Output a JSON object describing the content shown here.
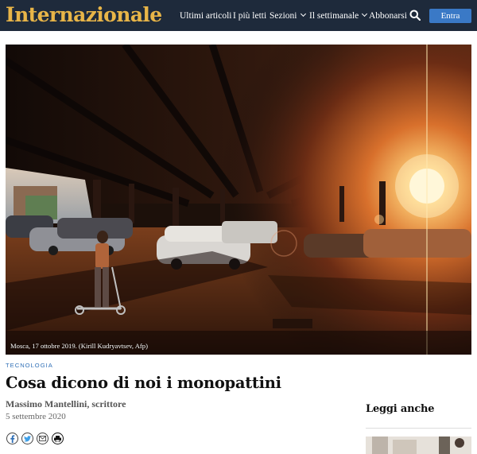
{
  "header": {
    "logo": "Internazionale",
    "nav": [
      {
        "label": "Ultimi articoli",
        "dropdown": false
      },
      {
        "label": "I più letti",
        "dropdown": false
      },
      {
        "label": "Sezioni",
        "dropdown": true
      },
      {
        "label": "Il settimanale",
        "dropdown": true
      },
      {
        "label": "Abbonarsi",
        "dropdown": false
      }
    ],
    "search_icon": "search-icon",
    "login_label": "Entra"
  },
  "hero": {
    "caption": "Mosca, 17 ottobre 2019. (Kirill Kudryavtsev, Afp)"
  },
  "article": {
    "category": "TECNOLOGIA",
    "title": "Cosa dicono di noi i monopattini",
    "author": "Massimo Mantellini, scrittore",
    "date": "5 settembre 2020",
    "share_icons": [
      "facebook-icon",
      "twitter-icon",
      "email-icon",
      "print-icon"
    ]
  },
  "sidebar": {
    "heading": "Leggi anche"
  },
  "colors": {
    "header_bg": "#1e2a3b",
    "logo": "#e8b548",
    "accent": "#3a79c6",
    "category": "#2f6fb6"
  }
}
